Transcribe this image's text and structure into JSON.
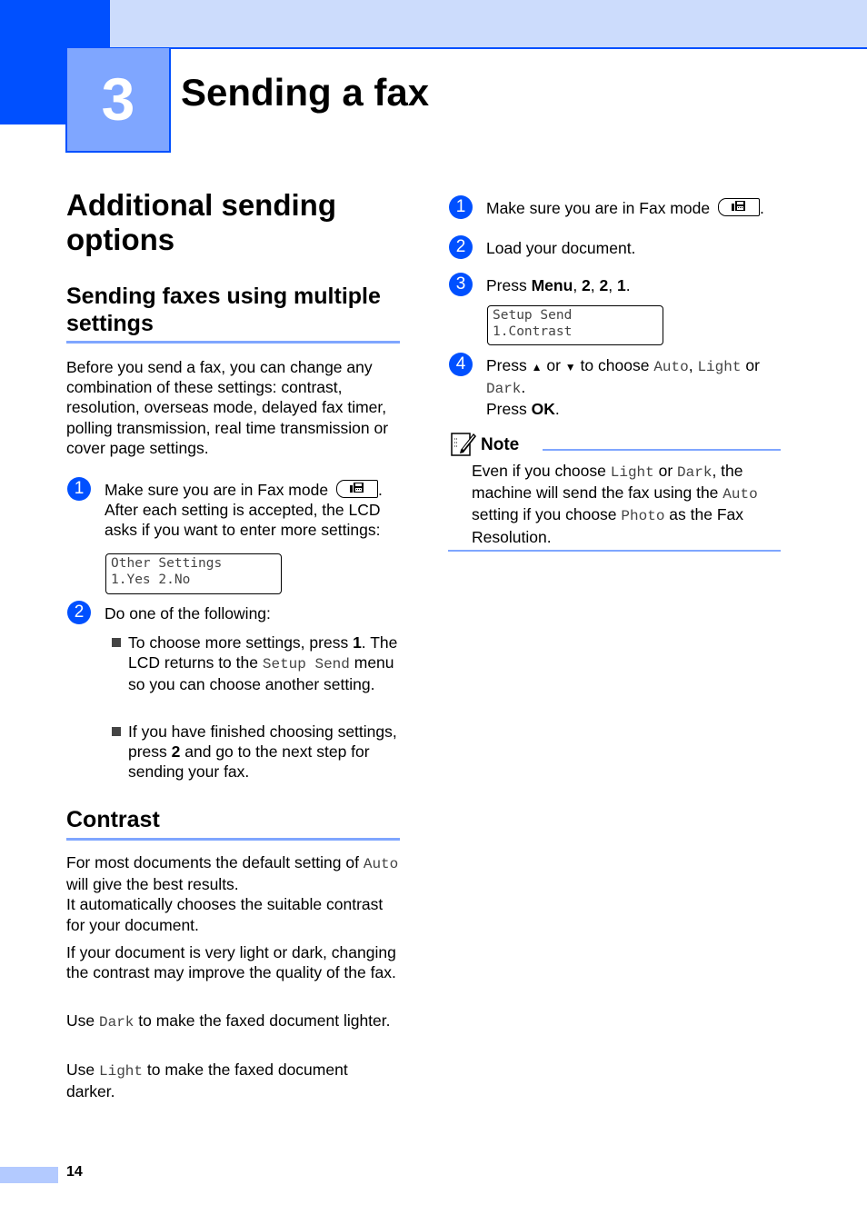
{
  "header": {
    "chapter_number": "3",
    "chapter_title": "Sending a fax"
  },
  "left": {
    "section_title": "Additional sending options",
    "subsection1_title": "Sending faxes using multiple settings",
    "intro": "Before you send a fax, you can change any combination of these settings: contrast, resolution, overseas mode, delayed fax timer, polling transmission, real time transmission or cover page settings.",
    "steps": [
      {
        "number": "1",
        "text_before_icon": "Make sure you are in Fax mode",
        "icon": "fax-key-icon",
        "text_after": "After each setting is accepted, the LCD asks if you want to enter more settings:",
        "lcd": [
          "Other Settings",
          "1.Yes 2.No"
        ]
      },
      {
        "number": "2",
        "text": "Do one of the following:"
      }
    ],
    "bullets": [
      {
        "part1": "To choose more settings, press ",
        "bold1": "1",
        "part2": ". The LCD returns to the ",
        "mono": "Setup Send",
        "part3": " menu so you can choose another setting."
      },
      {
        "part1": "If you have finished choosing settings, press ",
        "bold1": "2",
        "part2": " and go to the next step for sending your fax."
      }
    ],
    "subsection2_title": "Contrast",
    "contrast_paragraphs": [
      {
        "t1": "For most documents the default setting of ",
        "mono": "Auto",
        "t2": " will give the best results."
      },
      {
        "t1": "It automatically chooses the suitable contrast for your document."
      },
      {
        "t1": "If your document is very light or dark, changing the contrast may improve the quality of the fax."
      },
      {
        "t1": "Use ",
        "mono": "Dark",
        "t2": " to make the faxed document lighter."
      },
      {
        "t1": "Use ",
        "mono": "Light",
        "t2": " to make the faxed document darker."
      }
    ]
  },
  "right": {
    "steps": [
      {
        "number": "1",
        "text": "Make sure you are in Fax mode",
        "icon": "fax-key-icon"
      },
      {
        "number": "2",
        "text": "Load your document."
      },
      {
        "number": "3",
        "text": "Press ",
        "bold": [
          "Menu",
          "2",
          "2",
          "1"
        ],
        "lcd": [
          "Setup Send",
          "1.Contrast"
        ]
      },
      {
        "number": "4",
        "t1": "Press ",
        "up": "▲",
        "t2": " or ",
        "down": "▼",
        "t3": " to choose ",
        "m1": "Auto",
        "t4": ", ",
        "m2": "Light",
        "t5": " or ",
        "m3": "Dark",
        "t6": ".",
        "line2": "Press ",
        "bold": "OK"
      }
    ],
    "note": {
      "title": "Note",
      "t1": "Even if you choose ",
      "m1": "Light",
      "t2": " or ",
      "m2": "Dark",
      "t3": ", the machine will send the fax using the ",
      "m3": "Auto",
      "t4": " setting if you choose ",
      "m4": "Photo",
      "t5": " as the Fax Resolution."
    }
  },
  "footer": {
    "page_number": "14"
  }
}
